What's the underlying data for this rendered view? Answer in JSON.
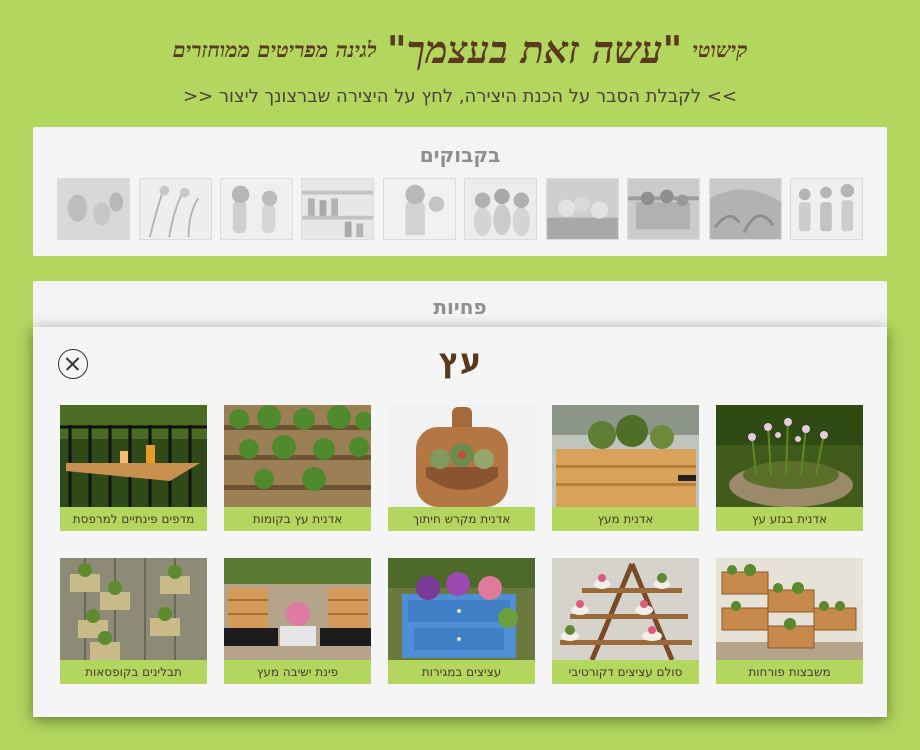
{
  "header": {
    "title_pre": "קישוטי",
    "title_main": "\"עשה זאת בעצמך\"",
    "title_post": "לגינה מפריטים ממוחזרים",
    "instructions": ">> לקבלת הסבר על הכנת היצירה, לחץ על היצירה שברצונך ליצור <<"
  },
  "sections": {
    "bottles": {
      "title": "בקבוקים",
      "thumbs": [
        {
          "name": "bottle-thumb-1"
        },
        {
          "name": "bottle-thumb-2"
        },
        {
          "name": "bottle-thumb-3"
        },
        {
          "name": "bottle-thumb-4"
        },
        {
          "name": "bottle-thumb-5"
        },
        {
          "name": "bottle-thumb-6"
        },
        {
          "name": "bottle-thumb-7"
        },
        {
          "name": "bottle-thumb-8"
        },
        {
          "name": "bottle-thumb-9"
        },
        {
          "name": "bottle-thumb-10"
        }
      ]
    },
    "cans": {
      "title": "פחיות"
    }
  },
  "modal": {
    "title": "עץ",
    "close_label": "",
    "items": [
      {
        "label": "אדנית בגזע עץ"
      },
      {
        "label": "אדנית מעץ"
      },
      {
        "label": "אדנית מקרש חיתוך"
      },
      {
        "label": "אדנית עץ בקומות"
      },
      {
        "label": "מדפים פינתיים למרפסת"
      },
      {
        "label": "משבצות פורחות"
      },
      {
        "label": "סולם עציצים דקורטיבי"
      },
      {
        "label": "עציצים במגירות"
      },
      {
        "label": "פינת ישיבה מעץ"
      },
      {
        "label": "תבלינים בקופסאות"
      }
    ]
  },
  "colors": {
    "background": "#b2d65e",
    "title_brown": "#5a3a1e",
    "panel": "#f4f4f4",
    "label_bar": "#b2d65e"
  }
}
